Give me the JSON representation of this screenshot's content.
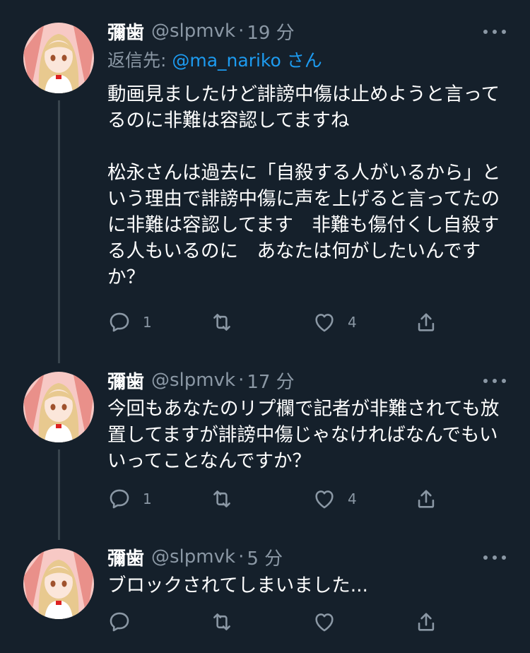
{
  "tweets": [
    {
      "name": "彌歯",
      "handle": "@slpmvk",
      "dot": "·",
      "time": "19 分",
      "reply_label": "返信先: ",
      "reply_mention": "@ma_nariko",
      "reply_suffix": " さん",
      "text": "動画見ましたけど誹謗中傷は止めようと言ってるのに非難は容認してますね\n\n松永さんは過去に「自殺する人がいるから」という理由で誹謗中傷に声を上げると言ってたのに非難は容認してます　非難も傷付くし自殺する人もいるのに　あなたは何がしたいんですか？",
      "reply_count": "1",
      "retweet_count": "",
      "like_count": "4"
    },
    {
      "name": "彌歯",
      "handle": "@slpmvk",
      "dot": "·",
      "time": "17 分",
      "text": "今回もあなたのリプ欄で記者が非難されても放置してますが誹謗中傷じゃなければなんでもいいってことなんですか？",
      "reply_count": "1",
      "retweet_count": "",
      "like_count": "4"
    },
    {
      "name": "彌歯",
      "handle": "@slpmvk",
      "dot": "·",
      "time": "5 分",
      "text": "ブロックされてしまいました...",
      "reply_count": "",
      "retweet_count": "",
      "like_count": ""
    }
  ],
  "icons": {
    "more": "more-horizontal-icon",
    "reply": "reply-bubble-icon",
    "retweet": "retweet-arrows-icon",
    "like": "heart-icon",
    "share": "share-upload-icon"
  },
  "colors": {
    "background": "#15202b",
    "secondary_text": "#8b98a5",
    "mention": "#1d9bf0",
    "thread_line": "#38444d",
    "avatar_background": "#f7c9c5"
  }
}
